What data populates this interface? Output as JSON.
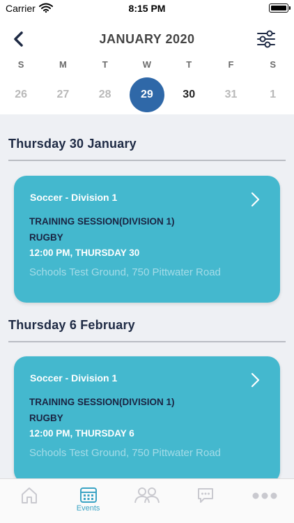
{
  "status_bar": {
    "carrier": "Carrier",
    "time": "8:15 PM"
  },
  "header": {
    "month_title": "JANUARY 2020",
    "weekdays": [
      "S",
      "M",
      "T",
      "W",
      "T",
      "F",
      "S"
    ],
    "dates": [
      "26",
      "27",
      "28",
      "29",
      "30",
      "31",
      "1"
    ],
    "selected_date": "29"
  },
  "sections": [
    {
      "heading": "Thursday 30 January",
      "event": {
        "division": "Soccer - Division 1",
        "title": "TRAINING SESSION(DIVISION 1)",
        "sport": "RUGBY",
        "datetime": "12:00 PM, THURSDAY 30",
        "location": "Schools Test Ground, 750 Pittwater Road"
      }
    },
    {
      "heading": "Thursday 6 February",
      "event": {
        "division": "Soccer - Division 1",
        "title": "TRAINING SESSION(DIVISION 1)",
        "sport": "RUGBY",
        "datetime": "12:00 PM, THURSDAY 6",
        "location": "Schools Test Ground, 750 Pittwater Road"
      }
    }
  ],
  "tab_bar": {
    "active_tab": "events",
    "tabs": [
      {
        "id": "home",
        "icon": "home-icon",
        "label": ""
      },
      {
        "id": "events",
        "icon": "calendar-icon",
        "label": "Events"
      },
      {
        "id": "people",
        "icon": "people-icon",
        "label": ""
      },
      {
        "id": "messages",
        "icon": "chat-icon",
        "label": ""
      },
      {
        "id": "more",
        "icon": "more-icon",
        "label": ""
      }
    ]
  },
  "colors": {
    "accent": "#2f68a8",
    "card": "#44b8ce",
    "heading": "#1e2a44",
    "active_tab": "#3aa3c4",
    "inactive_tab": "#c9c9cf"
  }
}
